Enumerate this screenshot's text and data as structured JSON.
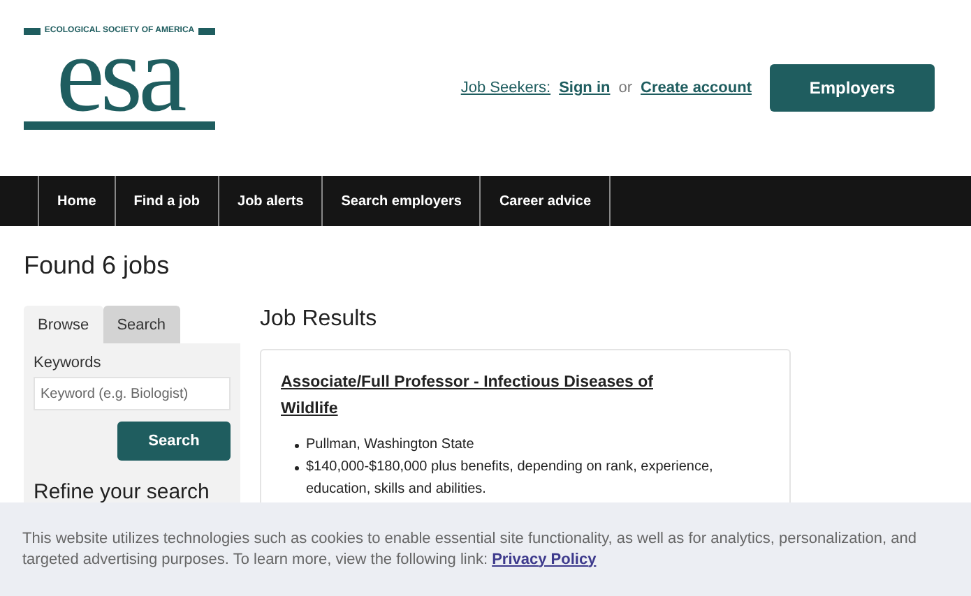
{
  "logo": {
    "tagline": "ECOLOGICAL SOCIETY OF AMERICA",
    "wordmark": "esa"
  },
  "account": {
    "label": "Job Seekers:",
    "sign_in": "Sign in",
    "separator": "or",
    "create": "Create account"
  },
  "employers_button": "Employers",
  "nav": [
    {
      "label": "Home"
    },
    {
      "label": "Find a job"
    },
    {
      "label": "Job alerts"
    },
    {
      "label": "Search employers"
    },
    {
      "label": "Career advice"
    }
  ],
  "heading": "Found 6 jobs",
  "sidebar": {
    "tabs": [
      {
        "label": "Browse",
        "selected": true
      },
      {
        "label": "Search",
        "selected": false
      }
    ],
    "keywords_label": "Keywords",
    "keywords_field": {
      "placeholder": "Keyword (e.g. Biologist)"
    },
    "search_button": "Search",
    "refine_title": "Refine your search"
  },
  "results": {
    "title": "Job Results",
    "jobs": [
      {
        "title": "Associate/Full Professor - Infectious Diseases of Wildlife",
        "details": [
          "Pullman, Washington State",
          "$140,000-$180,000 plus benefits, depending on rank, experience, education, skills and abilities."
        ]
      }
    ]
  },
  "cookie_banner": {
    "text": "This website utilizes technologies such as cookies to enable essential site functionality, as well as for analytics, personalization, and targeted advertising purposes. To learn more, view the following link:",
    "link": "Privacy Policy"
  }
}
